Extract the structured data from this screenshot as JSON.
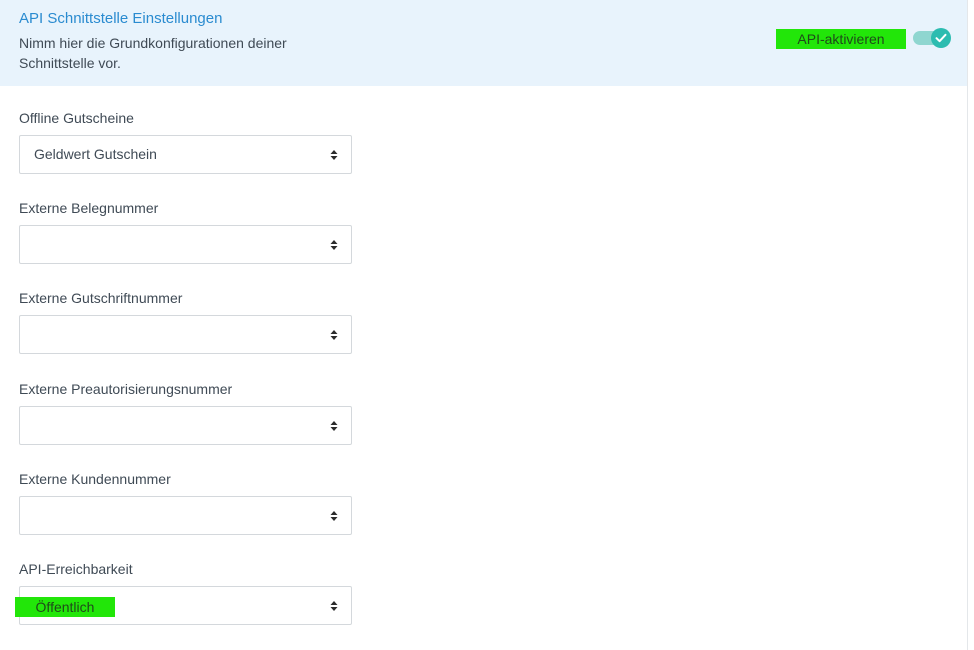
{
  "header": {
    "title": "API Schnittstelle Einstellungen",
    "description": "Nimm hier die Grundkonfigurationen deiner Schnittstelle vor.",
    "toggle_label": "API-aktivieren",
    "toggle_on": true
  },
  "fields": [
    {
      "label": "Offline Gutscheine",
      "value": "Geldwert Gutschein"
    },
    {
      "label": "Externe Belegnummer",
      "value": ""
    },
    {
      "label": "Externe Gutschriftnummer",
      "value": ""
    },
    {
      "label": "Externe Preautorisierungsnummer",
      "value": ""
    },
    {
      "label": "Externe Kundennummer",
      "value": ""
    },
    {
      "label": "API-Erreichbarkeit",
      "value": "Öffentlich"
    }
  ],
  "colors": {
    "accent": "#2a8bd0",
    "header_bg": "#e8f3fc",
    "toggle": "#2cbcb0",
    "highlight": "#22e609"
  }
}
